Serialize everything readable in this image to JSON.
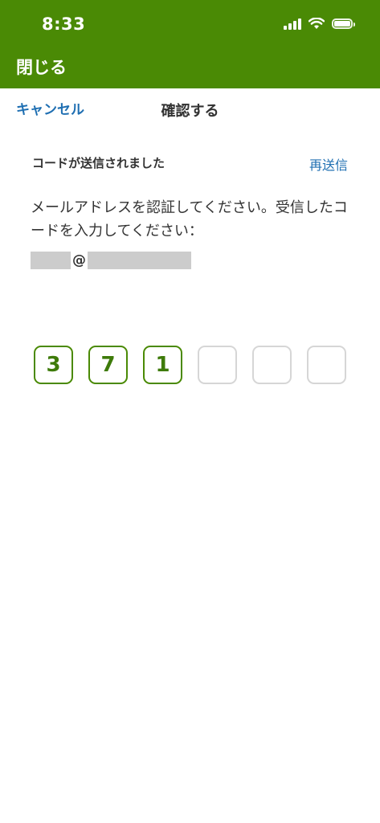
{
  "status_bar": {
    "time": "8:33"
  },
  "header": {
    "close_label": "閉じる"
  },
  "nav": {
    "cancel_label": "キャンセル",
    "title": "確認する"
  },
  "content": {
    "sent_message": "コードが送信されました",
    "resend_label": "再送信",
    "instruction": "メールアドレスを認証してください。受信したコードを入力してください：",
    "email_at": "@"
  },
  "code": {
    "digits": [
      "3",
      "7",
      "1",
      "",
      "",
      ""
    ]
  },
  "colors": {
    "header_bg": "#4a8a05",
    "link": "#1f6fb2",
    "digit_text": "#3e7b0a",
    "empty_border": "#d6d6d6"
  }
}
